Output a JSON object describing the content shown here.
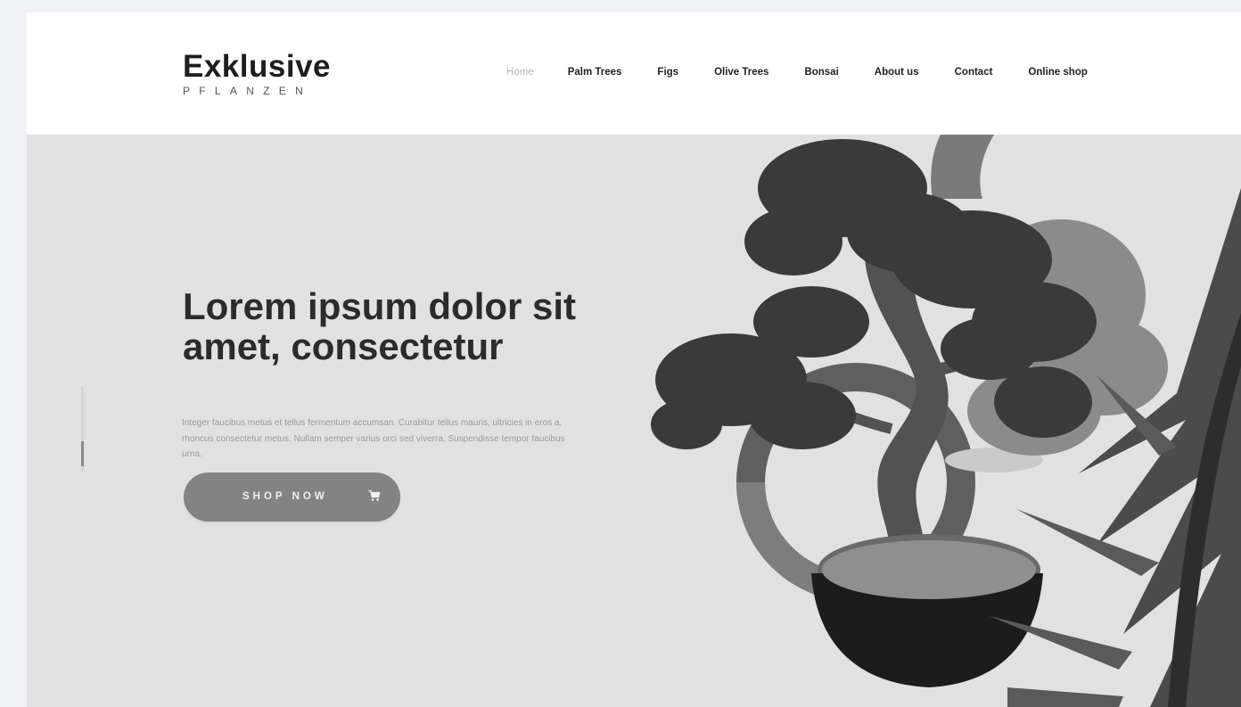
{
  "brand": {
    "name": "Exklusive",
    "tagline": "PFLANZEN"
  },
  "nav": {
    "items": [
      {
        "label": "Home",
        "active": true
      },
      {
        "label": "Palm Trees",
        "active": false
      },
      {
        "label": "Figs",
        "active": false
      },
      {
        "label": "Olive Trees",
        "active": false
      },
      {
        "label": "Bonsai",
        "active": false
      },
      {
        "label": "About us",
        "active": false
      },
      {
        "label": "Contact",
        "active": false
      },
      {
        "label": "Online shop",
        "active": false
      }
    ]
  },
  "hero": {
    "title": "Lorem ipsum dolor sit amet, consectetur",
    "text": "Integer faucibus metus et tellus fermentum accumsan. Curabitur tellus mauris, ultricies in eros a, rhoncus consectetur metus. Nullam semper varius orci sed viverra. Suspendisse tempor faucibus urna.",
    "button_label": "SHOP NOW",
    "button_icon": "cart-icon",
    "image_icon": "bonsai-tree-icon"
  },
  "slider": {
    "icon": "vertical-slider-indicator"
  },
  "colors": {
    "page_background": "#f1f2f5",
    "header_background": "#ffffff",
    "hero_background": "#e1e1e1",
    "title": "#2b2b2b",
    "body_text": "#9a9a9a",
    "button": "#838383",
    "nav_active": "#b8b8b8",
    "nav_text": "#222222"
  }
}
